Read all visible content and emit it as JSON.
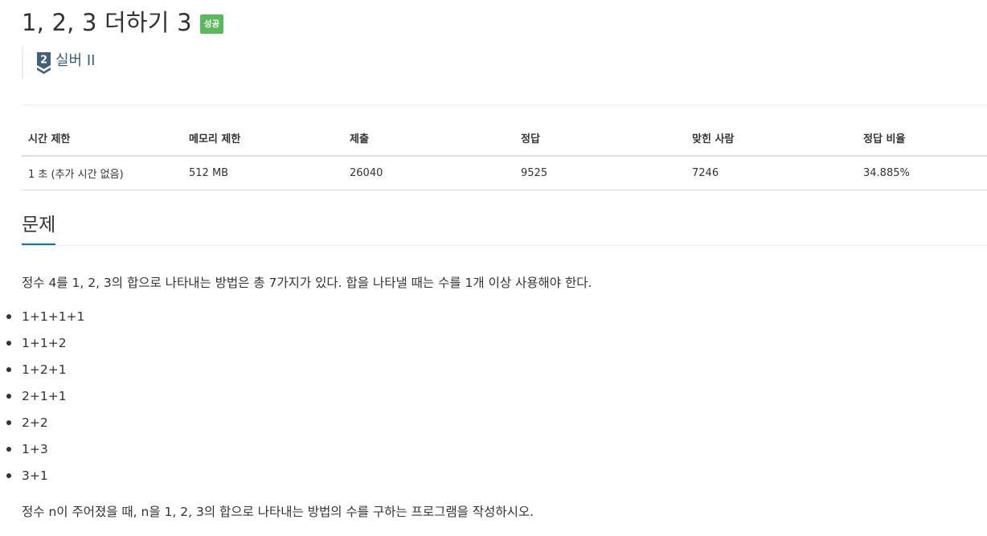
{
  "problem": {
    "title": "1, 2, 3 더하기 3",
    "status_badge": "성공",
    "tier_label": "실버 II",
    "tier_number": "2",
    "status_color": "#5cb85c",
    "tier_color": "#435f7a"
  },
  "stats": {
    "headers": [
      "시간 제한",
      "메모리 제한",
      "제출",
      "정답",
      "맞힌 사람",
      "정답 비율"
    ],
    "values": [
      "1 초 (추가 시간 없음)",
      "512 MB",
      "26040",
      "9525",
      "7246",
      "34.885%"
    ]
  },
  "section": {
    "title": "문제"
  },
  "description": {
    "intro": "정수 4를 1, 2, 3의 합으로 나타내는 방법은 총 7가지가 있다. 합을 나타낼 때는 수를 1개 이상 사용해야 한다.",
    "examples": [
      "1+1+1+1",
      "1+1+2",
      "1+2+1",
      "2+1+1",
      "2+2",
      "1+3",
      "3+1"
    ],
    "outro": "정수 n이 주어졌을 때, n을 1, 2, 3의 합으로 나타내는 방법의 수를 구하는 프로그램을 작성하시오."
  }
}
